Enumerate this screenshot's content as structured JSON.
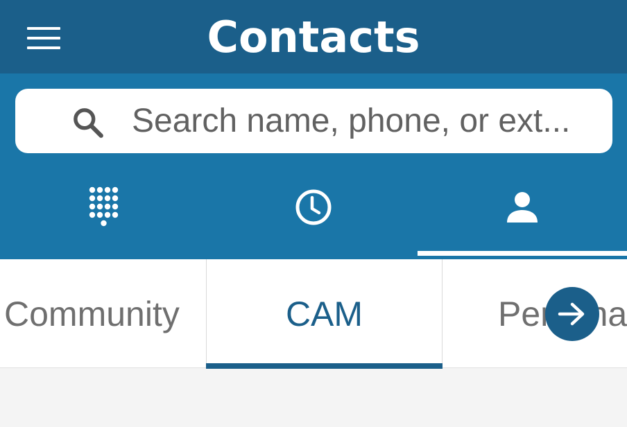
{
  "header": {
    "title": "Contacts",
    "menu_icon": "hamburger-menu-icon",
    "background": "#1b5f8a"
  },
  "search": {
    "placeholder": "Search name, phone, or ext...",
    "value": "",
    "icon": "search-icon"
  },
  "nav_tabs": [
    {
      "name": "dialpad",
      "icon": "dialpad-icon",
      "active": false
    },
    {
      "name": "recents",
      "icon": "clock-icon",
      "active": false
    },
    {
      "name": "contacts",
      "icon": "person-icon",
      "active": true
    }
  ],
  "sub_tabs": [
    {
      "label": "Community",
      "active": false
    },
    {
      "label": "CAM",
      "active": true
    },
    {
      "label": "Personal",
      "active": false
    }
  ],
  "scroll_button": {
    "icon": "arrow-right-icon"
  },
  "colors": {
    "header": "#1b5f8a",
    "band": "#1a76a8",
    "accent": "#1b5f8a",
    "background": "#f4f4f4"
  }
}
